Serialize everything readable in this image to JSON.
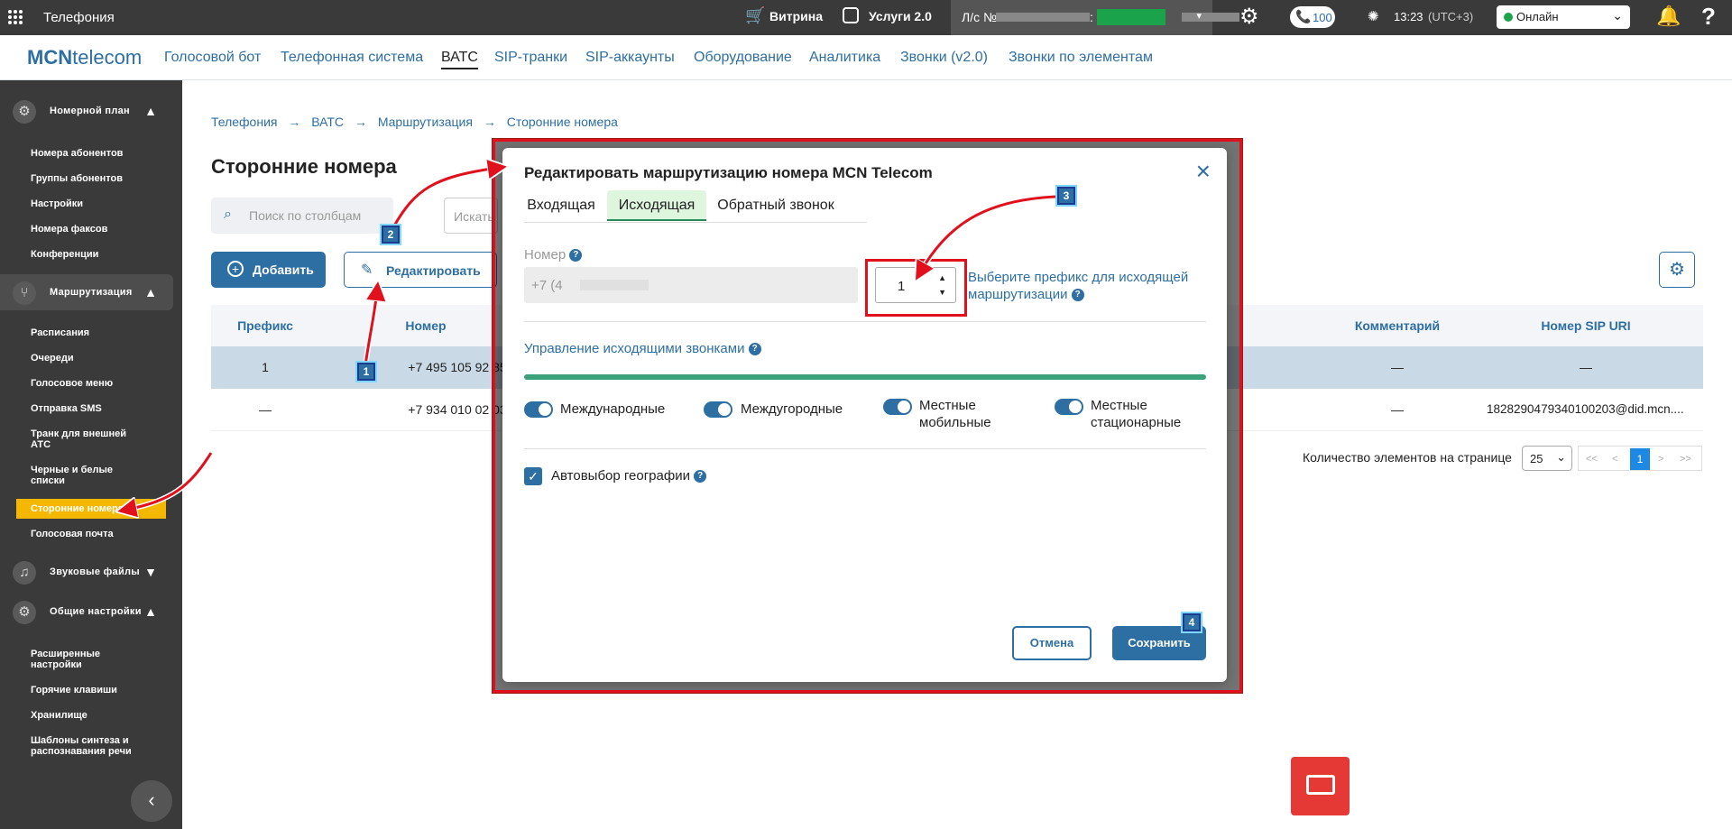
{
  "topbar": {
    "app_title": "Телефония",
    "showcase": "Витрина",
    "services": "Услуги 2.0",
    "account_label": "Л/с №",
    "account_colon": ":",
    "calls_count": "100",
    "time": "13:23",
    "timezone": "(UTC+3)",
    "status": "Онлайн"
  },
  "nav": {
    "logo_bold": "MCN",
    "logo_rest": "telecom",
    "items": [
      "Голосовой бот",
      "Телефонная система",
      "ВАТС",
      "SIP-транки",
      "SIP-аккаунты",
      "Оборудование",
      "Аналитика",
      "Звонки (v2.0)",
      "Звонки по элементам"
    ]
  },
  "sidebar": {
    "sections": [
      "Номерной план",
      "Маршрутизация",
      "Звуковые файлы",
      "Общие настройки"
    ],
    "numbering_items": [
      "Номера абонентов",
      "Группы абонентов",
      "Настройки",
      "Номера факсов",
      "Конференции"
    ],
    "routing_items": [
      "Расписания",
      "Очереди",
      "Голосовое меню",
      "Отправка SMS",
      "Транк для внешней АТС",
      "Черные и белые списки",
      "Сторонние номера",
      "Голосовая почта"
    ],
    "general_items": [
      "Расширенные настройки",
      "Горячие клавиши",
      "Хранилище",
      "Шаблоны синтеза и распознавания речи"
    ]
  },
  "breadcrumb": [
    "Телефония",
    "ВАТС",
    "Маршрутизация",
    "Сторонние номера"
  ],
  "page_title": "Сторонние номера",
  "search_placeholder": "Поиск по столбцам",
  "search2_placeholder": "Искать",
  "buttons": {
    "add": "Добавить",
    "edit": "Редактировать"
  },
  "table": {
    "headers": [
      "Префикс",
      "Номер",
      "Комментарий",
      "Номер SIP URI"
    ],
    "rows": [
      {
        "prefix": "1",
        "number": "+7 495 105 92 85",
        "comment": "—",
        "sip": "—"
      },
      {
        "prefix": "—",
        "number": "+7 934 010 02 03",
        "comment": "—",
        "sip": "1828290479340100203@did.mcn...."
      }
    ]
  },
  "pagination": {
    "label": "Количество элементов на странице",
    "per_page": "25",
    "current": "1",
    "first": "<<",
    "prev": "<",
    "next": ">",
    "last": ">>"
  },
  "modal": {
    "title": "Редактировать маршрутизацию номера MCN Telecom",
    "tabs": [
      "Входящая",
      "Исходящая",
      "Обратный звонок"
    ],
    "active_tab": "Исходящая",
    "number_label": "Номер",
    "number_value": "+7 (4",
    "prefix_value": "1",
    "prefix_hint": "Выберите префикс для исходящей маршрутизации",
    "calls_section": "Управление исходящими звонками",
    "toggles": [
      "Международные",
      "Междугородные",
      "Местные мобильные",
      "Местные стационарные"
    ],
    "geo_label": "Автовыбор географии",
    "cancel": "Отмена",
    "save": "Сохранить"
  },
  "annotations": [
    "1",
    "2",
    "3",
    "4"
  ],
  "colors": {
    "brand": "#2d6fa3",
    "highlight": "#f5b800",
    "annotation": "#e0101c",
    "topbar": "#3a3a3a"
  }
}
